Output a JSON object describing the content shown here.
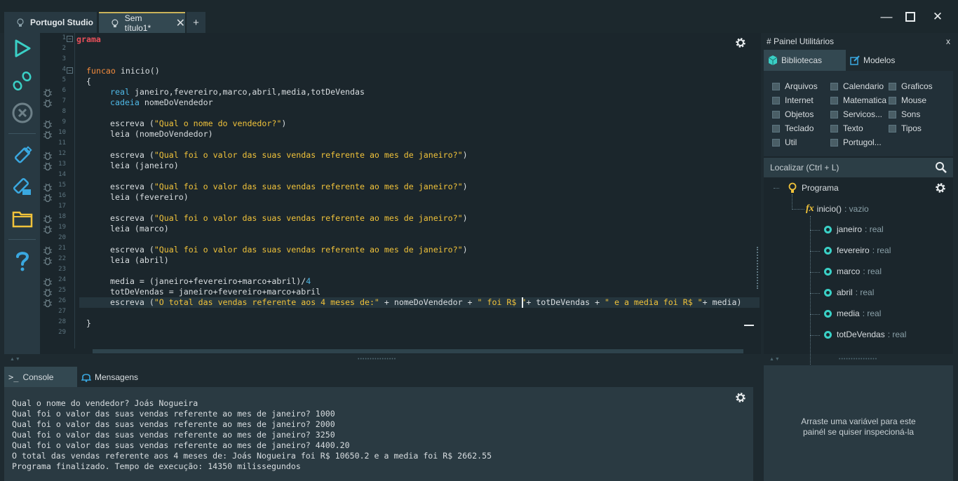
{
  "window": {
    "tabs": [
      {
        "label": "Portugol Studio"
      },
      {
        "label": "Sem título1*"
      }
    ],
    "add_tab": "+",
    "controls": {
      "minimize": "—",
      "maximize": "□",
      "close": "✕"
    }
  },
  "toolbar": {
    "items": [
      "run-icon",
      "debug-step-icon",
      "stop-icon",
      "save-icon",
      "save-as-icon",
      "open-folder-icon",
      "help-icon"
    ]
  },
  "editor": {
    "line_numbers": [
      "1",
      "2",
      "3",
      "4",
      "5",
      "6",
      "7",
      "8",
      "9",
      "10",
      "11",
      "12",
      "13",
      "14",
      "15",
      "16",
      "17",
      "18",
      "19",
      "20",
      "21",
      "22",
      "23",
      "24",
      "25",
      "26",
      "27",
      "28",
      "29"
    ],
    "lines": [
      "grama",
      "",
      "",
      "funcao inicio()",
      "{",
      "real janeiro,fevereiro,marco,abril,media,totDeVendas",
      "cadeia nomeDoVendedor",
      "",
      "escreva (\"Qual o nome do vendedor?\")",
      "leia (nomeDoVendedor)",
      "",
      "escreva (\"Qual foi o valor das suas vendas referente ao mes de janeiro?\")",
      "leia (janeiro)",
      "",
      "escreva (\"Qual foi o valor das suas vendas referente ao mes de janeiro?\")",
      "leia (fevereiro)",
      "",
      "escreva (\"Qual foi o valor das suas vendas referente ao mes de janeiro?\")",
      "leia (marco)",
      "",
      "escreva (\"Qual foi o valor das suas vendas referente ao mes de janeiro?\")",
      "leia (abril)",
      "",
      "media = (janeiro+fevereiro+marco+abril)/4",
      "totDeVendas = janeiro+fevereiro+marco+abril",
      "escreva (\"O total das vendas referente aos 4 meses de:\" + nomeDoVendedor + \" foi R$ \"+ totDeVendas + \" e a media foi R$ \"+ media)",
      "",
      "}",
      ""
    ],
    "tokens": {
      "t_grama": "grama",
      "t_funcao": "funcao",
      "t_inicio": " inicio()",
      "t_brace_open": "{",
      "t_real": "real",
      "t_vars": " janeiro,fevereiro,marco,abril,media,totDeVendas",
      "t_cadeia": "cadeia",
      "t_nome": " nomeDoVendedor",
      "t_escreva": "escreva (",
      "t_close": ")",
      "t_s_nome": "\"Qual o nome do vendedor?\"",
      "t_leia_nome": "leia (nomeDoVendedor)",
      "t_s_valor": "\"Qual foi o valor das suas vendas referente ao mes de janeiro?\"",
      "t_leia_jan": "leia (janeiro)",
      "t_leia_fev": "leia (fevereiro)",
      "t_leia_mar": "leia (marco)",
      "t_leia_abr": "leia (abril)",
      "t_media_expr": "media = (janeiro+fevereiro+marco+abril)/",
      "t_four": "4",
      "t_tot_expr": "totDeVendas = janeiro+fevereiro+marco+abril",
      "t_s_total": "\"O total das vendas referente aos 4 meses de:\"",
      "t_plus_nome": " + nomeDoVendedor + ",
      "t_s_foi": "\" foi R$ \"",
      "t_plus_tot": "+ totDeVendas + ",
      "t_s_media": "\" e a media foi R$ \"",
      "t_plus_media": "+ media)",
      "t_brace_close": "}"
    }
  },
  "right_panel": {
    "title": "# Painel Utilitários",
    "close": "x",
    "tabs": {
      "libraries": "Bibliotecas",
      "models": "Modelos"
    },
    "libraries": [
      "Arquivos",
      "Calendario",
      "Graficos",
      "Internet",
      "Matematica",
      "Mouse",
      "Objetos",
      "Servicos...",
      "Sons",
      "Teclado",
      "Texto",
      "Tipos",
      "Util",
      "Portugol..."
    ],
    "search_label": "Localizar (Ctrl + L)",
    "tree": {
      "root": "Programa",
      "function_name": "inicio()",
      "function_type": " : vazio",
      "variables": [
        {
          "name": "janeiro",
          "type": " : real"
        },
        {
          "name": "fevereiro",
          "type": " : real"
        },
        {
          "name": "marco",
          "type": " : real"
        },
        {
          "name": "abril",
          "type": " : real"
        },
        {
          "name": "media",
          "type": " : real"
        },
        {
          "name": "totDeVendas",
          "type": " : real"
        }
      ]
    }
  },
  "console": {
    "tabs": {
      "console": "Console",
      "console_prefix": ">_",
      "messages": "Mensagens"
    },
    "lines": [
      "Qual o nome do vendedor? Joás Nogueira",
      "Qual foi o valor das suas vendas referente ao mes de janeiro? 1000",
      "Qual foi o valor das suas vendas referente ao mes de janeiro? 2000",
      "Qual foi o valor das suas vendas referente ao mes de janeiro? 3250",
      "Qual foi o valor das suas vendas referente ao mes de janeiro? 4400.20",
      "O total das vendas referente aos 4 meses de: Joás Nogueira foi R$ 10650.2 e a media foi R$ 2662.55",
      "Programa finalizado. Tempo de execução: 14350 milissegundos"
    ]
  },
  "inspector": {
    "line1": "Arraste uma variável para este",
    "line2": "painél se quiser inspecioná-la"
  },
  "colors": {
    "keyword": "#4fb8e6",
    "keyword_alt": "#f08a3c",
    "string": "#f0c23a",
    "program": "#e8505a",
    "variable_dot": "#3ad0c6",
    "accent_tab": "#c9b25a"
  }
}
